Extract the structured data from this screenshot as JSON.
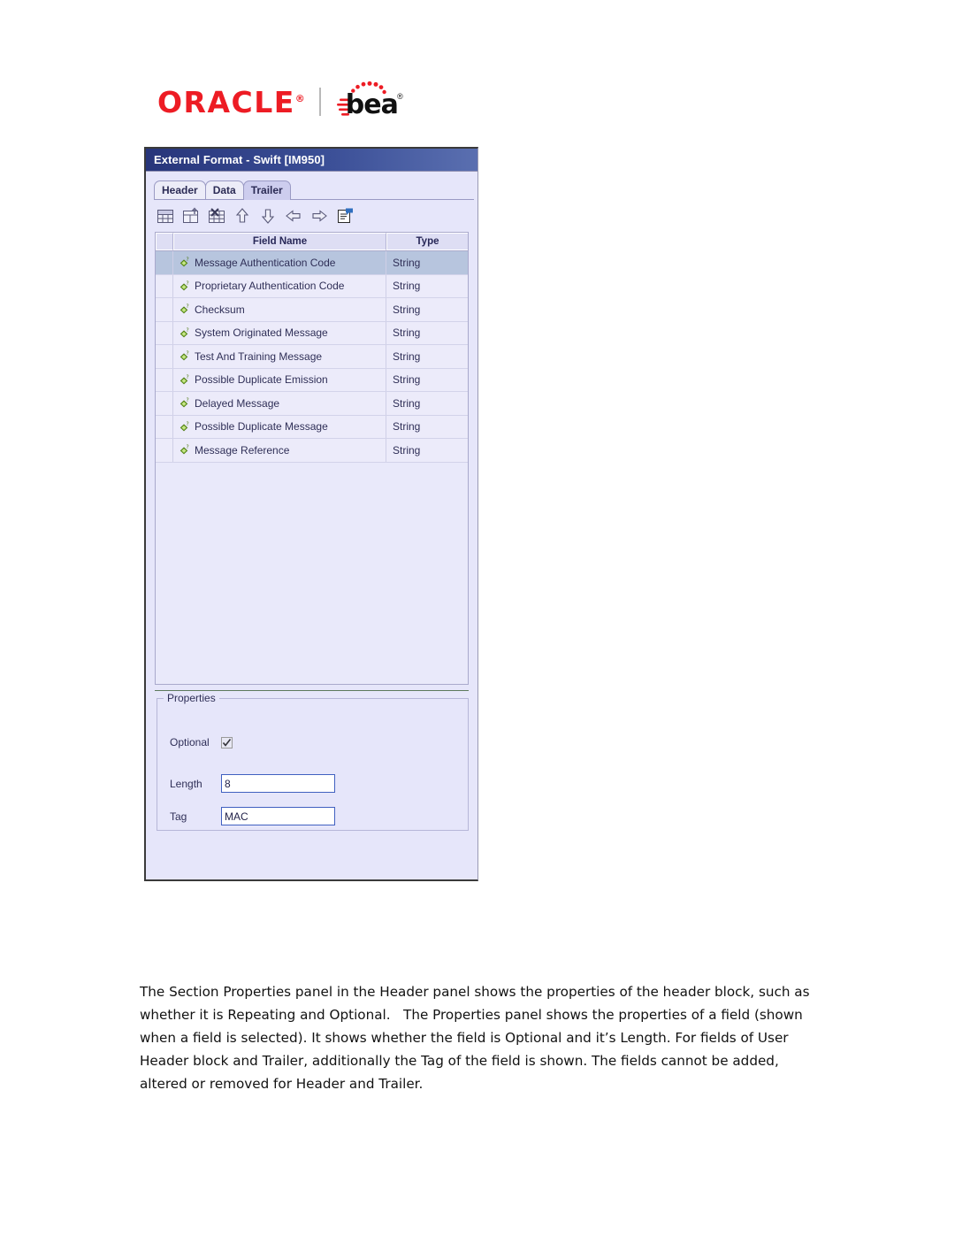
{
  "logo": {
    "oracle_text": "ORACLE",
    "oracle_registered": "®",
    "bea_text": "bea",
    "bea_registered": "®",
    "oracle_color": "#ed1c24",
    "bea_color": "#111111"
  },
  "window": {
    "title": "External Format - Swift [IM950]",
    "titlebar_color": "#27357a",
    "tabs": [
      {
        "label": "Header",
        "selected": false
      },
      {
        "label": "Data",
        "selected": false
      },
      {
        "label": "Trailer",
        "selected": true
      }
    ],
    "toolbar": [
      {
        "name": "insert-row-icon",
        "title": "Insert Row"
      },
      {
        "name": "add-field-icon",
        "title": "Add Field"
      },
      {
        "name": "delete-field-icon",
        "title": "Delete Field"
      },
      {
        "name": "move-up-icon",
        "title": "Move Up"
      },
      {
        "name": "move-down-icon",
        "title": "Move Down"
      },
      {
        "name": "move-left-icon",
        "title": "Move Left"
      },
      {
        "name": "move-right-icon",
        "title": "Move Right"
      },
      {
        "name": "properties-icon",
        "title": "Properties"
      }
    ],
    "grid": {
      "columns": [
        "",
        "Field Name",
        "Type"
      ],
      "selected_row_index": 0,
      "selected_row_color": "#b7c5de",
      "rows": [
        {
          "field_name": "Message Authentication Code",
          "type": "String"
        },
        {
          "field_name": "Proprietary Authentication Code",
          "type": "String"
        },
        {
          "field_name": "Checksum",
          "type": "String"
        },
        {
          "field_name": "System Originated Message",
          "type": "String"
        },
        {
          "field_name": "Test And Training Message",
          "type": "String"
        },
        {
          "field_name": "Possible Duplicate Emission",
          "type": "String"
        },
        {
          "field_name": "Delayed Message",
          "type": "String"
        },
        {
          "field_name": "Possible Duplicate Message",
          "type": "String"
        },
        {
          "field_name": "Message Reference",
          "type": "String"
        }
      ]
    },
    "properties": {
      "legend": "Properties",
      "optional_label": "Optional",
      "optional_checked": true,
      "length_label": "Length",
      "length_value": "8",
      "tag_label": "Tag",
      "tag_value": "MAC"
    }
  },
  "body": {
    "paragraph": "The Section Properties panel in the Header panel shows the properties of the header block, such as whether it is Repeating and Optional.   The Properties panel shows the properties of a field (shown when a field is selected). It shows whether the field is Optional and it’s Length. For fields of User Header block and Trailer, additionally the Tag of the field is shown. The fields cannot be added, altered or removed for Header and Trailer."
  }
}
